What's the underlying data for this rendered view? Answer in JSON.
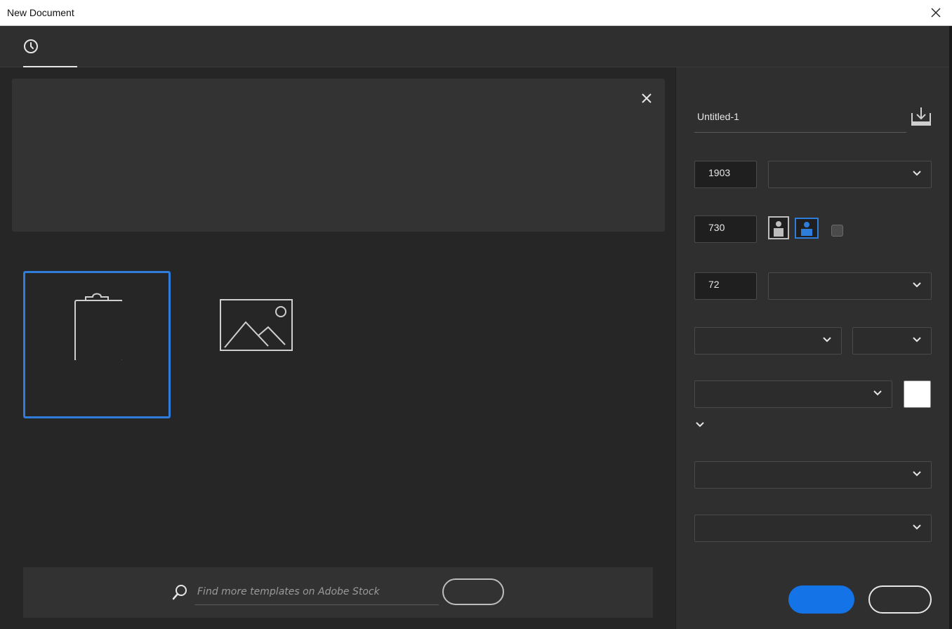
{
  "window": {
    "title": "New Document"
  },
  "tabs": [
    {
      "icon": "clock-icon",
      "active": true
    }
  ],
  "stock_search": {
    "placeholder": "Find more templates on Adobe Stock"
  },
  "details": {
    "document_name": "Untitled-1",
    "width": "1903",
    "height": "730",
    "resolution": "72"
  },
  "colors": {
    "accent": "#1473e6",
    "selection": "#2f7ddb",
    "background_swatch": "#ffffff"
  }
}
